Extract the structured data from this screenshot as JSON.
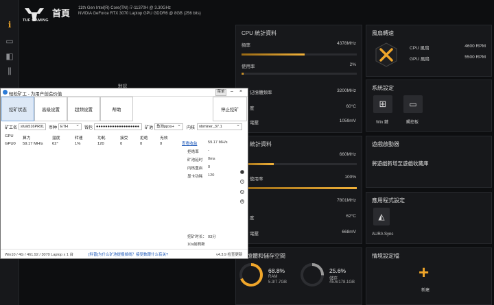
{
  "brand": "TUF GAMING",
  "page_title": "首頁",
  "specs": [
    "11th Gen Intel(R) Core(TM) i7-11370H @ 3.30GHz",
    "NVIDIA GeForce RTX 3070 Laptop GPU GDDR6 @ 8GB (256 bits)"
  ],
  "behind_label": "默認",
  "cpu": {
    "title": "CPU 統計資料",
    "freq_label": "頻率",
    "freq_val": "4378MHz",
    "freq_pct": 0.55,
    "usage_label": "使用率",
    "usage_val": "2%",
    "usage_pct": 0.02,
    "mem_freq_label": "记憶體頻率",
    "mem_freq_val": "3200MHz",
    "temp_label": "度",
    "temp_val": "60°C",
    "volt_label": "電壓",
    "volt_val": "1059mV"
  },
  "gpu": {
    "title": "U 統計資料",
    "freq_val": "660MHz",
    "freq_pct": 0.28,
    "usage_label": "使用率",
    "usage_val": "100%",
    "usage_pct": 1.0,
    "mem_val": "7801MHz",
    "temp_label": "度",
    "temp_val": "62°C",
    "volt_label": "電壓",
    "volt_val": "668mV"
  },
  "fan": {
    "title": "風扇轉速",
    "cpu_label": "CPU 風扇",
    "cpu_val": "4600 RPM",
    "gpu_label": "GPU 風扇",
    "gpu_val": "5500 RPM"
  },
  "system": {
    "title": "系統設定",
    "win_label": "Win 鍵",
    "touch_label": "觸控板"
  },
  "game_launcher": {
    "title": "遊戲啟動器",
    "text": "將遊戲新增至遊戲收藏庫"
  },
  "apps": {
    "title": "應用程式設定",
    "app_label": "AURA Sync"
  },
  "memory": {
    "title": "記憶體和儲存空間",
    "ram_pct": "68.8%",
    "ram_label": "RAM",
    "ram_val": "5.3/7.7GB",
    "ram_frac": 0.688,
    "disk_pct": "25.6%",
    "disk_label": "儲存",
    "disk_val": "45.6/178.1GB",
    "disk_frac": 0.256
  },
  "scenario": {
    "title": "情境設定檔",
    "new_label": "新建"
  },
  "miner": {
    "title": "轻松矿工 - 为用户创造价值",
    "menu_btn": "菜单",
    "tabs": [
      "挖矿状态",
      "高级设置",
      "超频设置",
      "帮助"
    ],
    "stop_btn": "停止挖矿",
    "worker_label": "矿工名",
    "worker_val": "sfuik516PR01",
    "coin_label": "币种",
    "coin_val": "ETH",
    "wallet_label": "钱包",
    "wallet_val": "●●●●●●●●●●●●●●●●●●●",
    "pool_label": "矿池",
    "pool_val": "鱼池ppxs+",
    "kernel_label": "内核",
    "kernel_val": "nbminer_37.1",
    "headers": [
      "GPU",
      "算力",
      "温度",
      "转速",
      "功耗",
      "接受",
      "拒绝",
      "无效"
    ],
    "row": [
      "GPU0",
      "59.17 MH/s",
      "62°",
      "1%",
      "120",
      "0",
      "0",
      "0"
    ],
    "stats": [
      {
        "label": "查看收益",
        "val": "59.17 MH/s"
      },
      {
        "label": "拒绝率",
        "val": "-"
      },
      {
        "label": "矿池延时",
        "val": "0ms"
      },
      {
        "label": "内核重启",
        "val": "0"
      },
      {
        "label": "显卡功耗",
        "val": "120"
      }
    ],
    "runtime_label": "挖矿时长：",
    "runtime_val": "03分",
    "runtime_note": "10s前刷新",
    "status_sys": "Win10 / 4G / 461.92 / 3070 Laptop x 1 台",
    "status_link": "[科普]为什么矿池提报掉线？接受数跟什么有关?",
    "version": "v4.3.9 检查更新"
  }
}
